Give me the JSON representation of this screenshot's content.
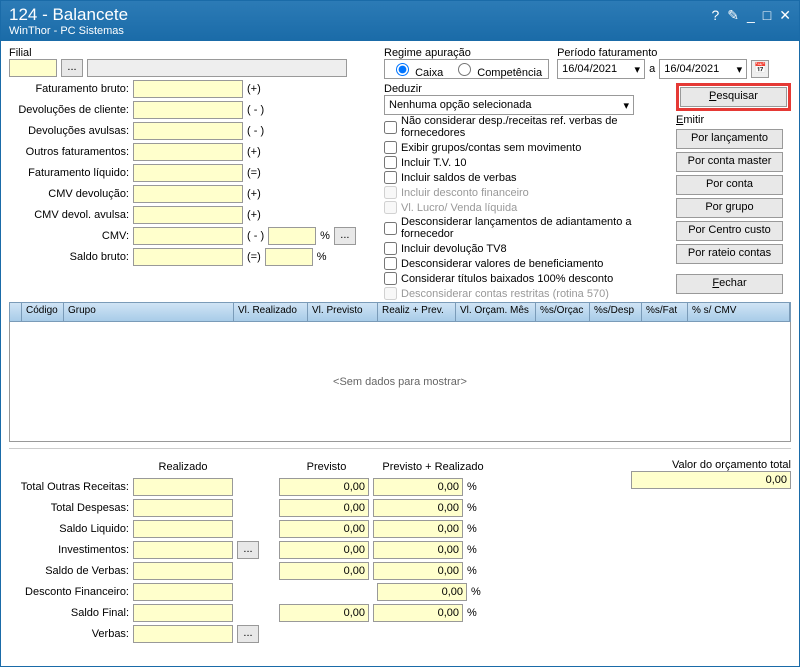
{
  "titlebar": {
    "title": "124 - Balancete",
    "subtitle": "WinThor - PC Sistemas",
    "help": "?",
    "edit": "✎",
    "min": "_",
    "max": "□",
    "close": "✕"
  },
  "filial": {
    "label": "Filial",
    "browse": "..."
  },
  "leftFields": {
    "fat_bruto": {
      "label": "Faturamento bruto:",
      "op": "(+)"
    },
    "dev_cliente": {
      "label": "Devoluções de cliente:",
      "op": "( - )"
    },
    "dev_avulsas": {
      "label": "Devoluções avulsas:",
      "op": "( - )"
    },
    "outros_fat": {
      "label": "Outros faturamentos:",
      "op": "(+)"
    },
    "fat_liquido": {
      "label": "Faturamento líquido:",
      "op": "(=)"
    },
    "cmv_dev": {
      "label": "CMV devolução:",
      "op": "(+)"
    },
    "cmv_dev_avulsa": {
      "label": "CMV devol. avulsa:",
      "op": "(+)"
    },
    "cmv": {
      "label": "CMV:",
      "op": "( - )",
      "pct": "%",
      "browse": "..."
    },
    "saldo_bruto": {
      "label": "Saldo bruto:",
      "op": "(=)",
      "pct": "%"
    }
  },
  "regime": {
    "label": "Regime apuração",
    "caixa": "Caixa",
    "comp": "Competência"
  },
  "periodo": {
    "label": "Período faturamento",
    "from": "16/04/2021",
    "a": "a",
    "to": "16/04/2021"
  },
  "deduzir": {
    "label": "Deduzir",
    "combo": "Nenhuma opção selecionada",
    "chk1": "Não considerar desp./receitas ref. verbas de fornecedores",
    "chk2": "Exibir grupos/contas sem movimento",
    "chk3": "Incluir T.V. 10",
    "chk4": "Incluir saldos de verbas",
    "chk5": "Incluir desconto financeiro",
    "chk6": "Vl. Lucro/ Venda líquida",
    "chk7": "Desconsiderar lançamentos de adiantamento a fornecedor",
    "chk8": "Incluir devolução TV8",
    "chk9": "Desconsiderar valores de beneficiamento",
    "chk10": "Considerar títulos baixados 100% desconto",
    "chk11": "Desconsiderar contas restritas (rotina 570)"
  },
  "buttons": {
    "pesquisar": "Pesquisar",
    "emitir": "Emitir",
    "por_lanc": "Por lançamento",
    "por_conta_master": "Por conta master",
    "por_conta": "Por conta",
    "por_grupo": "Por grupo",
    "por_centro": "Por Centro custo",
    "por_rateio": "Por rateio contas",
    "fechar": "Fechar"
  },
  "grid": {
    "cols": [
      "",
      "Código",
      "Grupo",
      "Vl. Realizado",
      "Vl. Previsto",
      "Realiz + Prev.",
      "Vl. Orçam. Mês",
      "%s/Orçac",
      "%s/Desp",
      "%s/Fat",
      "% s/ CMV"
    ],
    "empty": "<Sem dados para mostrar>"
  },
  "totals": {
    "headers": {
      "realizado": "Realizado",
      "previsto": "Previsto",
      "prev_real": "Previsto + Realizado"
    },
    "rows": {
      "outras_rec": "Total Outras Receitas:",
      "despesas": "Total Despesas:",
      "saldo_liq": "Saldo Liquido:",
      "invest": "Investimentos:",
      "saldo_verbas": "Saldo de Verbas:",
      "desc_fin": "Desconto Financeiro:",
      "saldo_final": "Saldo Final:",
      "verbas": "Verbas:"
    },
    "zero": "0,00",
    "pct": "%",
    "browse": "...",
    "orcamento_label": "Valor do orçamento total",
    "orcamento_val": "0,00"
  }
}
